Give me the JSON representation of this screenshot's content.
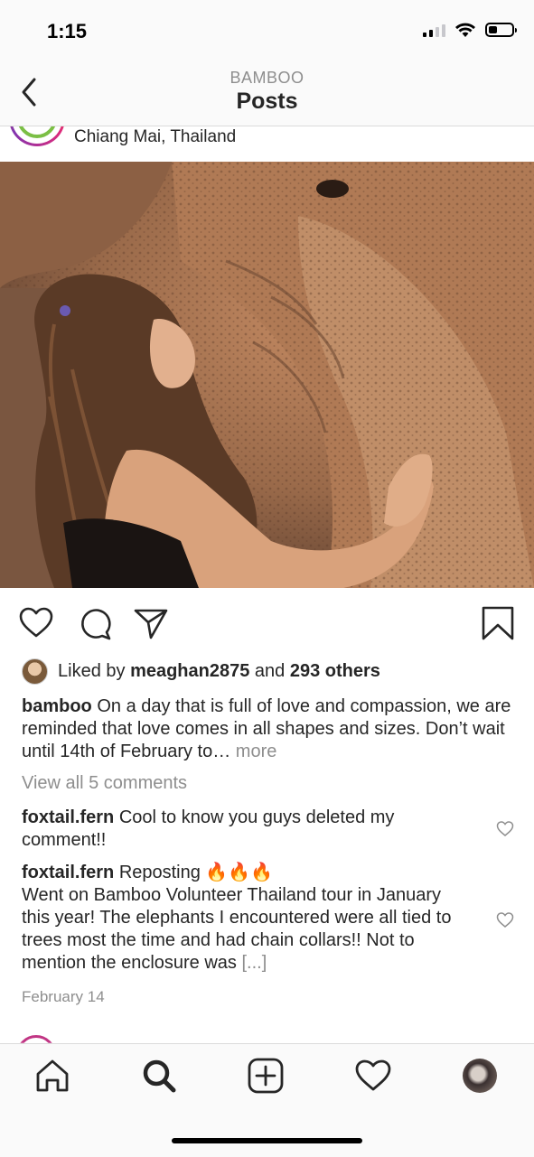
{
  "status_bar": {
    "time": "1:15"
  },
  "nav": {
    "subtitle": "BAMBOO",
    "title": "Posts"
  },
  "post": {
    "location": "Chiang Mai, Thailand",
    "likes": {
      "prefix": "Liked by",
      "user": "meaghan2875",
      "and": "and",
      "others": "293 others"
    },
    "caption": {
      "username": "bamboo",
      "text": "On a day that is full of love and compassion, we are reminded that love comes in all shapes and sizes. Don’t wait until 14th of February to…",
      "more": "more"
    },
    "view_all_comments": "View all 5 comments",
    "comments": [
      {
        "username": "foxtail.fern",
        "text": "Cool to know you guys deleted my comment!!"
      },
      {
        "username": "foxtail.fern",
        "text": "Reposting 🔥🔥🔥",
        "text2": "Went on Bamboo Volunteer Thailand tour in January this year! The elephants I encountered were all tied to trees most the time and had chain collars!! Not to mention the enclosure was",
        "truncated": "[...]"
      }
    ],
    "date": "February 14"
  },
  "icons": {
    "back": "chevron-left-icon",
    "like": "heart-icon",
    "comment": "comment-bubble-icon",
    "share": "paper-plane-icon",
    "save": "bookmark-icon",
    "tabs": [
      "home-icon",
      "search-icon",
      "add-post-icon",
      "activity-heart-icon",
      "profile-avatar"
    ]
  },
  "colors": {
    "accent_muted": "#8e8e8e",
    "text": "#262626",
    "bar_bg": "#fafafa"
  }
}
